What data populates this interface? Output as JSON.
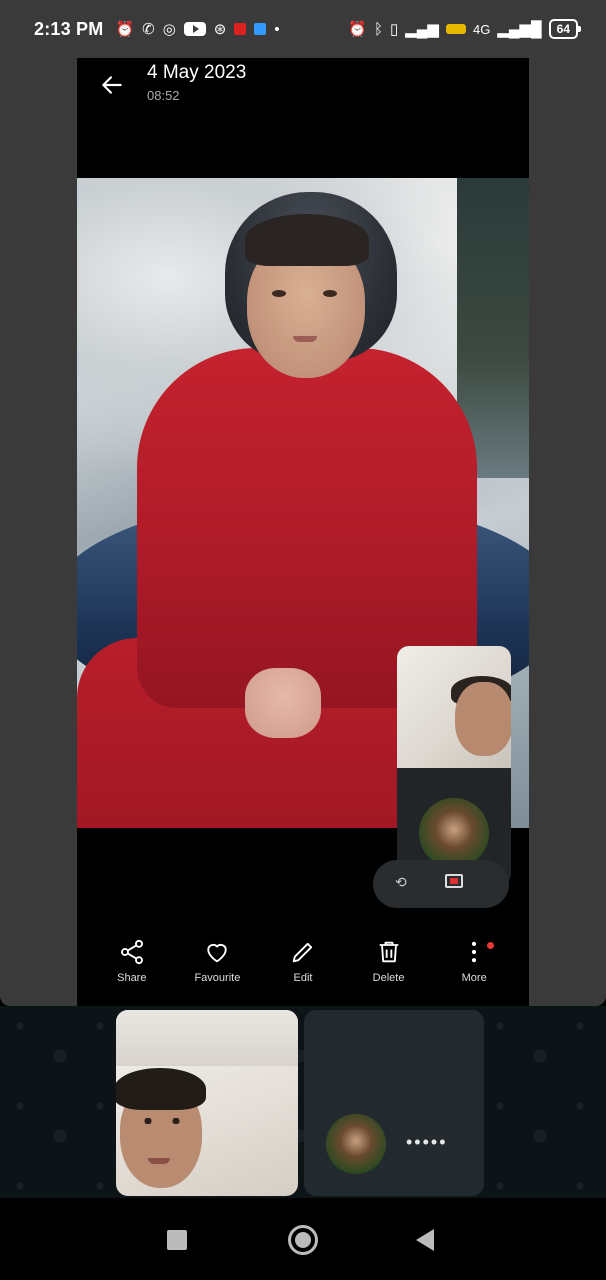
{
  "status_bar": {
    "time": "2:13 PM",
    "icons_left": [
      "alarm-icon",
      "missed-call-icon",
      "whatsapp-icon",
      "youtube-icon",
      "app-icon",
      "red-app-icon",
      "blue-app-icon",
      "dot-icon"
    ],
    "icons_right": [
      "alarm-icon",
      "bluetooth-icon",
      "vibrate-icon",
      "signal-icon",
      "volte-icon",
      "signal-4g-icon"
    ],
    "network": "4G",
    "battery": "64"
  },
  "gallery": {
    "date": "4 May 2023",
    "time": "08:52",
    "actions": [
      {
        "label": "Share",
        "icon": "share-icon"
      },
      {
        "label": "Favourite",
        "icon": "heart-icon"
      },
      {
        "label": "Edit",
        "icon": "pencil-icon"
      },
      {
        "label": "Delete",
        "icon": "trash-icon"
      },
      {
        "label": "More",
        "icon": "more-vertical-icon",
        "badge": true
      }
    ]
  },
  "call": {
    "remote_status": "•••••"
  },
  "navbar": {
    "buttons": [
      "recents-icon",
      "home-icon",
      "back-icon"
    ]
  },
  "colors": {
    "status_bg": "#3a3a3a",
    "call_bg": "#0d1418",
    "tile_bg": "#222a2f",
    "badge": "#e53935"
  }
}
